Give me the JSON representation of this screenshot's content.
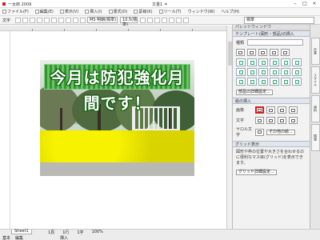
{
  "window": {
    "app_name": "一太郎 2009",
    "doc_title": "文書1 ＊"
  },
  "menu": [
    "ファイル(F)",
    "編集(E)",
    "表示(V)",
    "挿入(I)",
    "書式(O)",
    "罫線(K)",
    "ツール(T)",
    "ウィンドウ(W)",
    "ヘルプ(H)"
  ],
  "toolbar": {
    "mode_label": "文字",
    "font": "MS 明朝(標準)",
    "size": "10.5(標準)",
    "style": "標準"
  },
  "banner_text": "今月は防犯強化月間です！",
  "palette": {
    "header": "パレットウィンドウ",
    "section_template": "テンプレート(図形・部品)の挿入",
    "category_label": "種類",
    "part_button": "部品の詳細設定...",
    "section_image": "絵の挿入",
    "row_image": "画像",
    "row_text": "文字",
    "row_roll": "ヤロル文字",
    "other_button": "その他の絵...",
    "section_grid": "グリッド表示",
    "grid_desc": "図形や枠の位置や大きさを合わせるのに便利なマス目(グリッド)を表示できます。",
    "grid_button": "グリッド詳細設定..."
  },
  "right_tabs": [
    "作業",
    "スタイル",
    "資料",
    "情報"
  ],
  "status": {
    "sheet_tab": "Sheet1",
    "page": "1頁",
    "line": "1行",
    "col": "1字",
    "zoom": "100%",
    "mode": "基本",
    "edit": "編集",
    "insert": "挿入"
  }
}
